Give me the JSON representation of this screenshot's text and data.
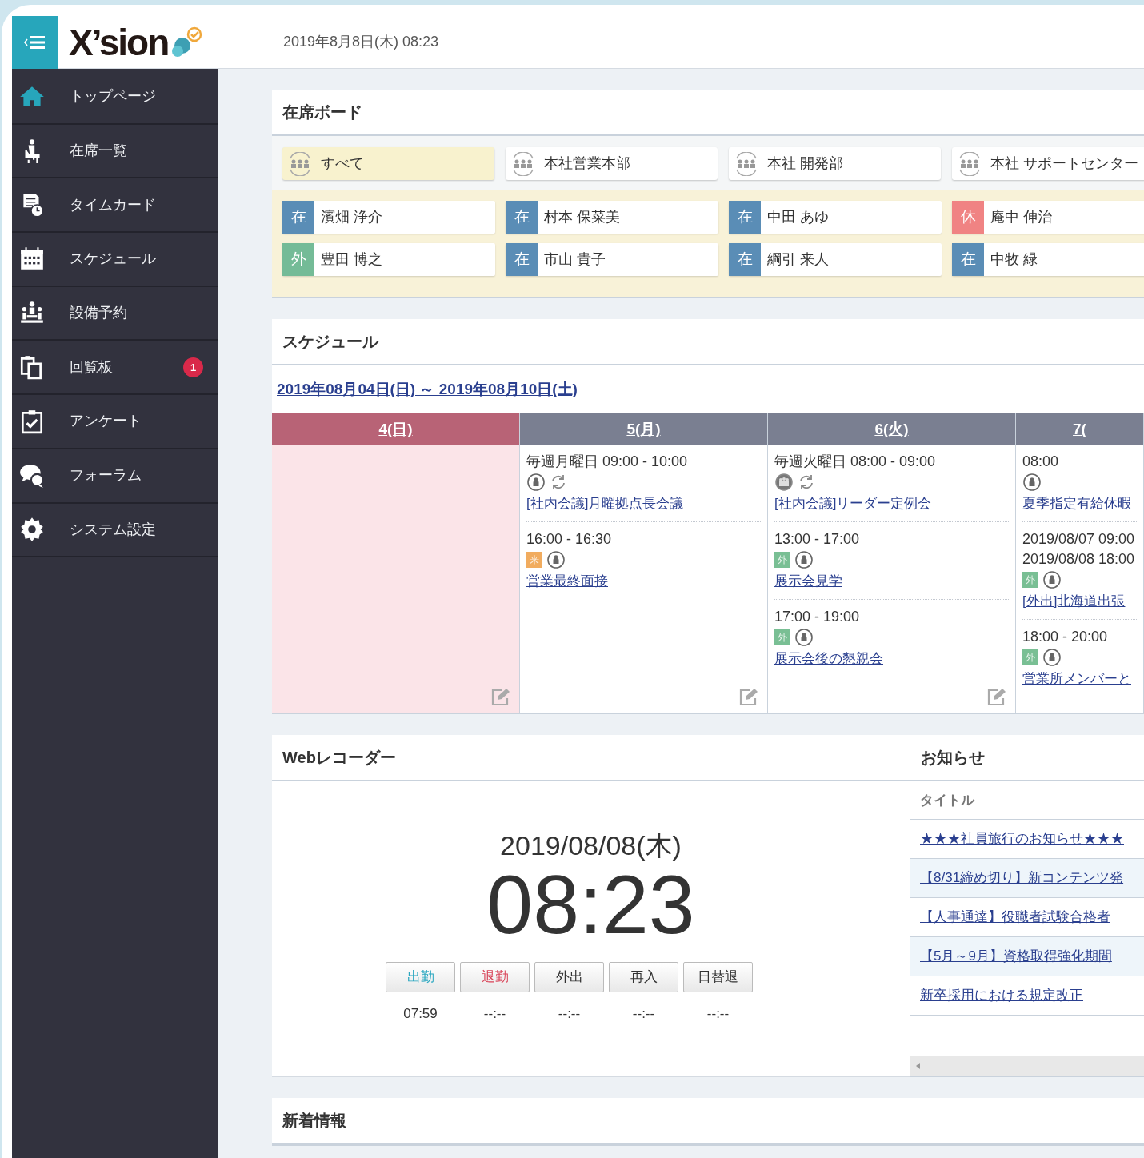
{
  "header": {
    "logo": "X’sion",
    "date": "2019年8月8日(木) 08:23"
  },
  "sidebar": {
    "items": [
      {
        "label": "トップページ"
      },
      {
        "label": "在席一覧"
      },
      {
        "label": "タイムカード"
      },
      {
        "label": "スケジュール"
      },
      {
        "label": "設備予約"
      },
      {
        "label": "回覧板",
        "badge": "1"
      },
      {
        "label": "アンケート"
      },
      {
        "label": "フォーラム"
      },
      {
        "label": "システム設定"
      }
    ]
  },
  "presence_board": {
    "title": "在席ボード",
    "groups": [
      {
        "label": "すべて",
        "selected": true
      },
      {
        "label": "本社営業本部",
        "selected": false
      },
      {
        "label": "本社 開発部",
        "selected": false
      },
      {
        "label": "本社 サポートセンター",
        "selected": false
      }
    ],
    "members": [
      {
        "status": "在",
        "kind": "present",
        "name": "濱畑 浄介"
      },
      {
        "status": "在",
        "kind": "present",
        "name": "村本 保菜美"
      },
      {
        "status": "在",
        "kind": "present",
        "name": "中田 あゆ"
      },
      {
        "status": "休",
        "kind": "leave",
        "name": "庵中 伸治"
      },
      {
        "status": "外",
        "kind": "out",
        "name": "豊田 博之"
      },
      {
        "status": "在",
        "kind": "present",
        "name": "市山 貴子"
      },
      {
        "status": "在",
        "kind": "present",
        "name": "綱引 来人"
      },
      {
        "status": "在",
        "kind": "present",
        "name": "中牧 緑"
      }
    ]
  },
  "schedule": {
    "title": "スケジュール",
    "range": "2019年08月04日(日) ～ 2019年08月10日(土)",
    "days": [
      {
        "label": "4(日)",
        "holiday": true,
        "edit_button": true
      },
      {
        "label": "5(月)",
        "holiday": false,
        "edit_button": true,
        "events": [
          {
            "time": [
              "毎週月曜日 09:00 - 10:00"
            ],
            "kind": "single",
            "recurring": true,
            "title": "[社内会議]月曜拠点長会議"
          },
          {
            "time": [
              "16:00 - 16:30"
            ],
            "tag": {
              "label": "来",
              "kind": "visitor"
            },
            "kind": "single",
            "recurring": false,
            "title": "営業最終面接"
          }
        ]
      },
      {
        "label": "6(火)",
        "holiday": false,
        "edit_button": true,
        "events": [
          {
            "time": [
              "毎週火曜日 08:00 - 09:00"
            ],
            "kind": "group",
            "recurring": true,
            "title": "[社内会議]リーダー定例会"
          },
          {
            "time": [
              "13:00 - 17:00"
            ],
            "tag": {
              "label": "外",
              "kind": "out"
            },
            "kind": "single",
            "recurring": false,
            "title": "展示会見学"
          },
          {
            "time": [
              "17:00 - 19:00"
            ],
            "tag": {
              "label": "外",
              "kind": "out"
            },
            "kind": "single",
            "recurring": false,
            "title": "展示会後の懇親会"
          }
        ]
      },
      {
        "label": "7(",
        "holiday": false,
        "edit_button": false,
        "events": [
          {
            "time": [
              "08:00"
            ],
            "kind": "single",
            "recurring": false,
            "title": "夏季指定有給休暇"
          },
          {
            "time": [
              "2019/08/07 09:00",
              "2019/08/08 18:00"
            ],
            "tag": {
              "label": "外",
              "kind": "out"
            },
            "kind": "single",
            "recurring": false,
            "title": "[外出]北海道出張"
          },
          {
            "time": [
              "18:00 - 20:00"
            ],
            "tag": {
              "label": "外",
              "kind": "out"
            },
            "kind": "single",
            "recurring": false,
            "title": "営業所メンバーと"
          }
        ]
      }
    ]
  },
  "web_recorder": {
    "title": "Webレコーダー",
    "date": "2019/08/08(木)",
    "time": "08:23",
    "buttons": [
      {
        "label": "出勤",
        "kind": "clock_in",
        "time": "07:59"
      },
      {
        "label": "退勤",
        "kind": "clock_out",
        "time": "--:--"
      },
      {
        "label": "外出",
        "kind": "plain",
        "time": "--:--"
      },
      {
        "label": "再入",
        "kind": "plain",
        "time": "--:--"
      },
      {
        "label": "日替退",
        "kind": "plain",
        "time": "--:--"
      }
    ]
  },
  "notices": {
    "title": "お知らせ",
    "column": "タイトル",
    "items": [
      "★★★社員旅行のお知らせ★★★",
      "【8/31締め切り】新コンテンツ発",
      "【人事通達】役職者試験合格者",
      "【5月～9月】資格取得強化期間",
      "新卒採用における規定改正"
    ]
  },
  "news": {
    "title": "新着情報"
  }
}
